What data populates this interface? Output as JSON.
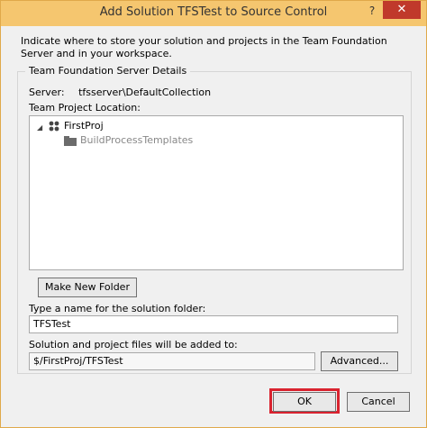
{
  "window": {
    "title": "Add Solution TFSTest to Source Control",
    "help_glyph": "?",
    "close_glyph": "✕"
  },
  "description": "Indicate where to store your solution and projects in the Team Foundation Server and in your workspace.",
  "group": {
    "label": "Team Foundation Server Details",
    "server_label": "Server:",
    "server_value": "tfsserver\\DefaultCollection",
    "project_location_label": "Team Project Location:",
    "tree": [
      {
        "label": "FirstProj",
        "icon": "team-project-icon",
        "expanded": true
      },
      {
        "label": "BuildProcessTemplates",
        "icon": "folder-icon",
        "disabled": true
      }
    ]
  },
  "buttons": {
    "make_new_folder": "Make New Folder",
    "advanced": "Advanced...",
    "ok": "OK",
    "cancel": "Cancel"
  },
  "solution_folder": {
    "label": "Type a name for the solution folder:",
    "value": "TFSTest"
  },
  "destination": {
    "label": "Solution and project files will be added to:",
    "value": "$/FirstProj/TFSTest"
  },
  "colors": {
    "titlebar": "#f5c66f",
    "highlight": "#d9232f"
  }
}
